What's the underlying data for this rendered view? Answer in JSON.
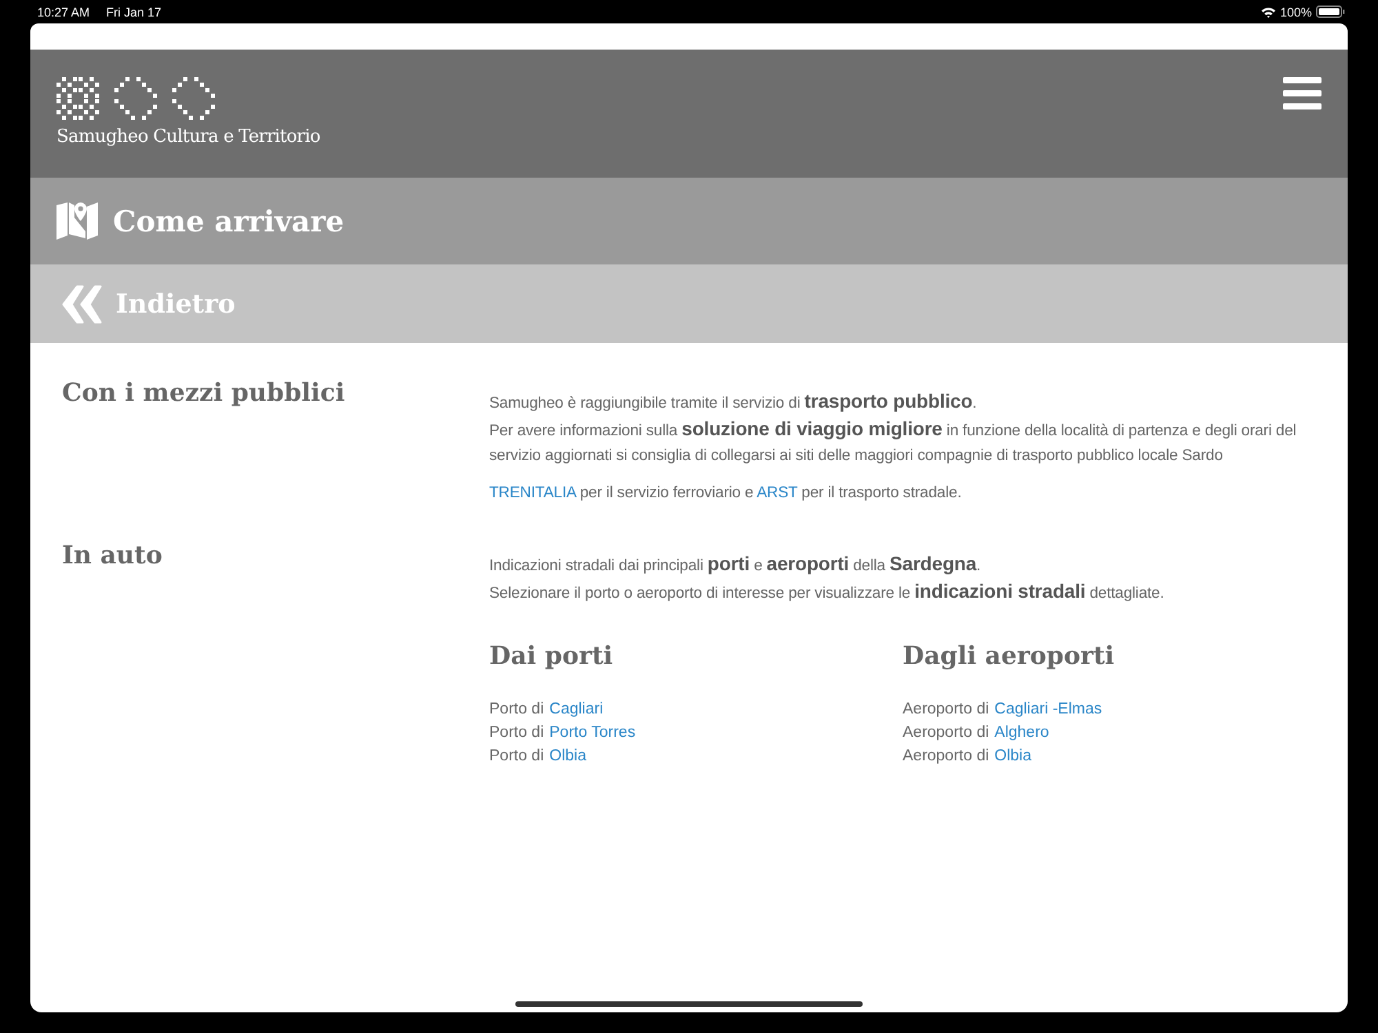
{
  "status_bar": {
    "time": "10:27 AM",
    "date": "Fri Jan 17",
    "battery": "100%"
  },
  "header": {
    "site_title": "Samugheo Cultura e Territorio"
  },
  "section_bar": {
    "title": "Come arrivare"
  },
  "back_bar": {
    "label": "Indietro"
  },
  "sections": [
    {
      "heading": "Con i mezzi pubblici",
      "paragraphs": [
        "Samugheo è raggiungibile tramite il servizio di **trasporto pubblico**.",
        "Per avere informazioni sulla **soluzione di viaggio migliore** in funzione della località di partenza e degli orari del servizio aggiornati si consiglia di collegarsi ai siti delle maggiori compagnie di trasporto pubblico locale Sardo"
      ],
      "link_sentence": [
        {
          "text": "TRENITALIA",
          "link": true
        },
        {
          "text": " per il servizio ferroviario e ",
          "link": false
        },
        {
          "text": "ARST",
          "link": true
        },
        {
          "text": " per il trasporto stradale.",
          "link": false
        }
      ]
    },
    {
      "heading": "In auto",
      "paragraphs": [
        "Indicazioni stradali dai principali **porti** e **aeroporti** della **Sardegna**.",
        "Selezionare il porto o aeroporto di interesse per visualizzare le **indicazioni stradali** dettagliate."
      ],
      "columns": [
        {
          "heading": "Dai porti",
          "items": [
            {
              "label": "Porto di",
              "link": "Cagliari"
            },
            {
              "label": "Porto di",
              "link": "Porto Torres"
            },
            {
              "label": "Porto di",
              "link": "Olbia"
            }
          ]
        },
        {
          "heading": "Dagli aeroporti",
          "items": [
            {
              "label": "Aeroporto di",
              "link": "Cagliari -Elmas"
            },
            {
              "label": "Aeroporto di",
              "link": "Alghero"
            },
            {
              "label": "Aeroporto di",
              "link": "Olbia"
            }
          ]
        }
      ]
    }
  ]
}
